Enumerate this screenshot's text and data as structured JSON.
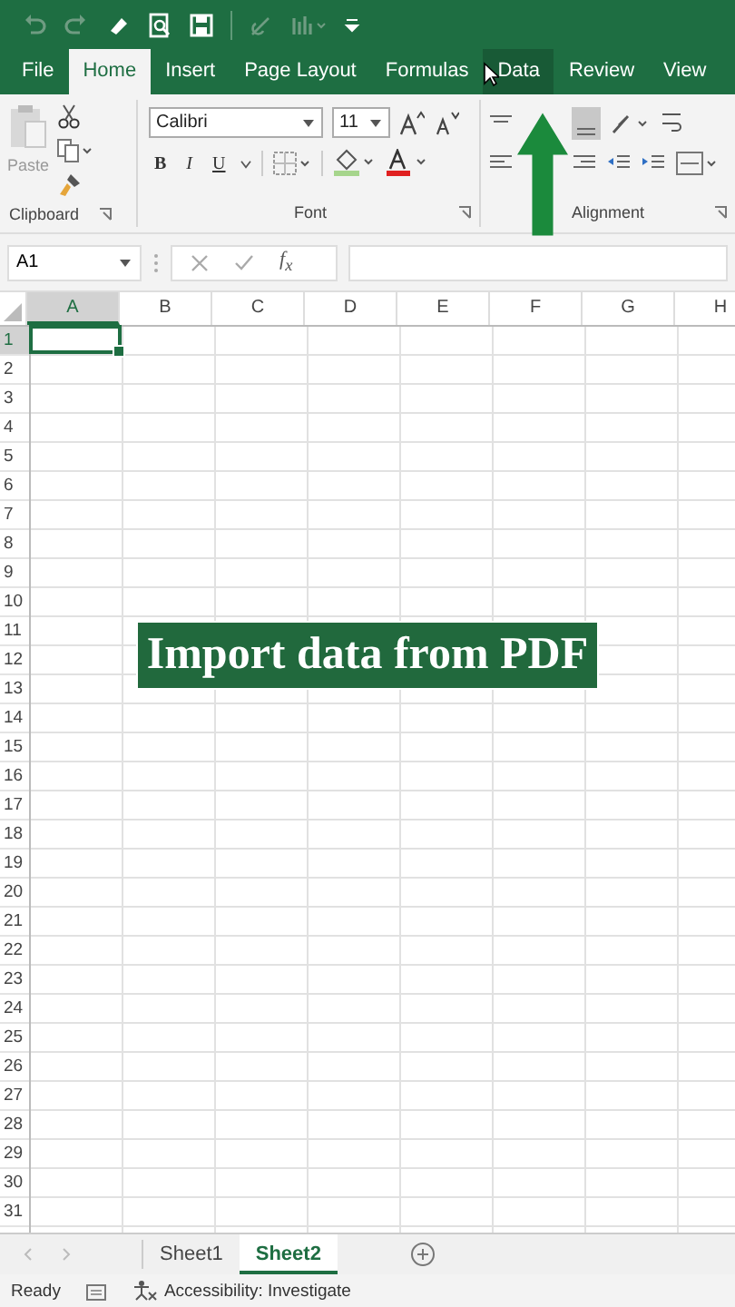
{
  "tabs": [
    {
      "label": "File",
      "selected": false
    },
    {
      "label": "Home",
      "selected": true
    },
    {
      "label": "Insert",
      "selected": false
    },
    {
      "label": "Page Layout",
      "selected": false
    },
    {
      "label": "Formulas",
      "selected": false
    },
    {
      "label": "Data",
      "selected": false,
      "hovered": true
    },
    {
      "label": "Review",
      "selected": false
    },
    {
      "label": "View",
      "selected": false
    }
  ],
  "ribbon": {
    "clipboard": {
      "paste": "Paste",
      "label": "Clipboard"
    },
    "font": {
      "name": "Calibri",
      "size": "11",
      "bold": "B",
      "italic": "I",
      "underline": "U",
      "label": "Font"
    },
    "alignment": {
      "label": "Alignment"
    }
  },
  "formula_bar": {
    "name_box": "A1",
    "fx": "f$_{x}$"
  },
  "sheet": {
    "columns": [
      {
        "label": "A",
        "selected": true
      },
      {
        "label": "B",
        "selected": false
      },
      {
        "label": "C",
        "selected": false
      },
      {
        "label": "D",
        "selected": false
      },
      {
        "label": "E",
        "selected": false
      },
      {
        "label": "F",
        "selected": false
      },
      {
        "label": "G",
        "selected": false
      },
      {
        "label": "H",
        "selected": false
      }
    ],
    "rows": [
      {
        "label": "1",
        "selected": true
      },
      {
        "label": "2",
        "selected": false
      },
      {
        "label": "3",
        "selected": false
      },
      {
        "label": "4",
        "selected": false
      },
      {
        "label": "5",
        "selected": false
      },
      {
        "label": "6",
        "selected": false
      },
      {
        "label": "7",
        "selected": false
      },
      {
        "label": "8",
        "selected": false
      },
      {
        "label": "9",
        "selected": false
      },
      {
        "label": "10",
        "selected": false
      },
      {
        "label": "11",
        "selected": false
      },
      {
        "label": "12",
        "selected": false
      },
      {
        "label": "13",
        "selected": false
      },
      {
        "label": "14",
        "selected": false
      },
      {
        "label": "15",
        "selected": false
      },
      {
        "label": "16",
        "selected": false
      },
      {
        "label": "17",
        "selected": false
      },
      {
        "label": "18",
        "selected": false
      },
      {
        "label": "19",
        "selected": false
      },
      {
        "label": "20",
        "selected": false
      },
      {
        "label": "21",
        "selected": false
      },
      {
        "label": "22",
        "selected": false
      },
      {
        "label": "23",
        "selected": false
      },
      {
        "label": "24",
        "selected": false
      },
      {
        "label": "25",
        "selected": false
      },
      {
        "label": "26",
        "selected": false
      },
      {
        "label": "27",
        "selected": false
      },
      {
        "label": "28",
        "selected": false
      },
      {
        "label": "29",
        "selected": false
      },
      {
        "label": "30",
        "selected": false
      },
      {
        "label": "31",
        "selected": false
      }
    ]
  },
  "caption": "Import data from PDF",
  "sheet_tabs": [
    {
      "label": "Sheet1",
      "selected": false
    },
    {
      "label": "Sheet2",
      "selected": true
    }
  ],
  "status_bar": {
    "ready": "Ready",
    "accessibility": "Accessibility: Investigate"
  }
}
